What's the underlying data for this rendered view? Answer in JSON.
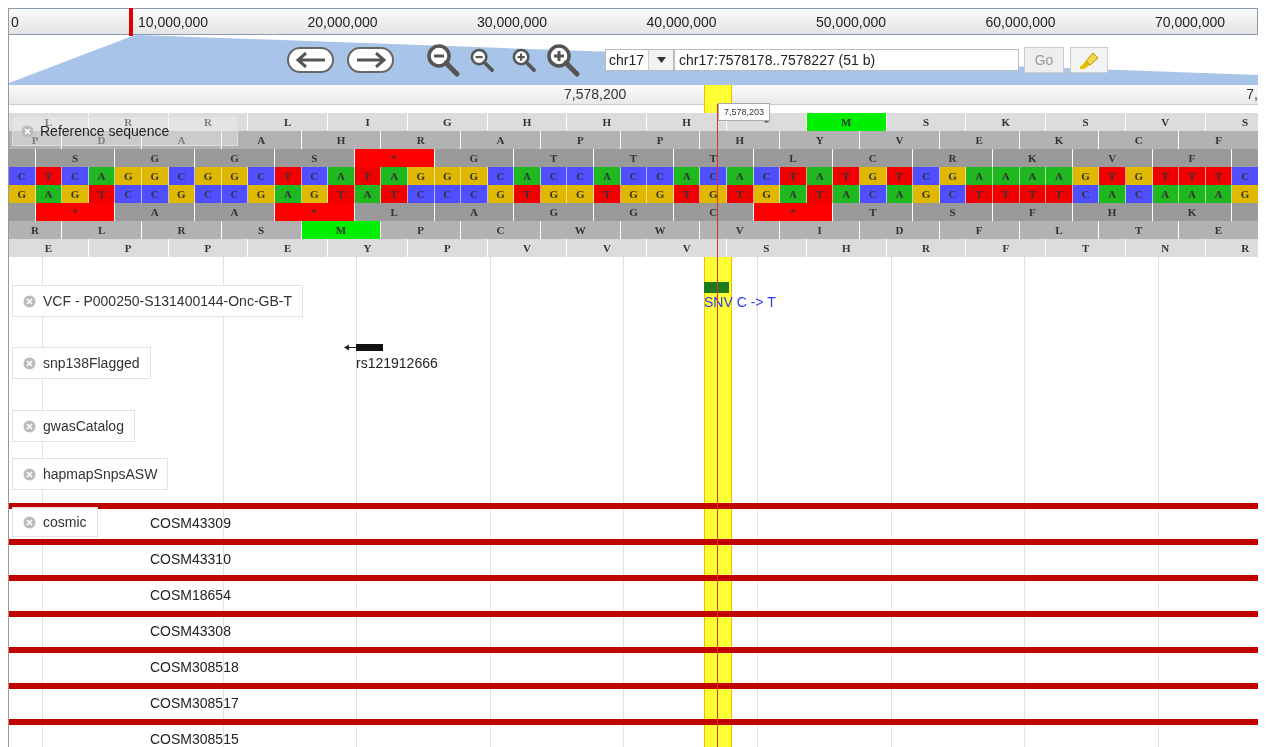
{
  "overview": {
    "ticks": [
      "0",
      "10,000,000",
      "20,000,000",
      "30,000,000",
      "40,000,000",
      "50,000,000",
      "60,000,000",
      "70,000,000"
    ]
  },
  "navigation": {
    "chromosome": "chr17",
    "location": "chr17:7578178..7578227 (51 b)",
    "go": {
      "label": "Go",
      "disabled": true
    }
  },
  "ruler": {
    "labels": [
      "7,578,200",
      "7,"
    ]
  },
  "position_tooltip": "7,578,203",
  "reference_track": {
    "label": "Reference sequence",
    "frames_top": [
      {
        "kind": "light",
        "cells": [
          {
            "aa": "L",
            "kind": "amino"
          },
          {
            "aa": "R",
            "kind": "amino"
          },
          {
            "aa": "R",
            "kind": "amino"
          },
          {
            "aa": "L",
            "kind": "amino"
          },
          {
            "aa": "I",
            "kind": "amino"
          },
          {
            "aa": "G",
            "kind": "amino"
          },
          {
            "aa": "H",
            "kind": "amino"
          },
          {
            "aa": "H",
            "kind": "amino"
          },
          {
            "aa": "H",
            "kind": "amino"
          },
          {
            "aa": "*",
            "kind": "amino"
          },
          {
            "aa": "M",
            "kind": "start"
          },
          {
            "aa": "S",
            "kind": "amino"
          },
          {
            "aa": "K",
            "kind": "amino"
          },
          {
            "aa": "S",
            "kind": "amino"
          },
          {
            "aa": "V",
            "kind": "amino"
          },
          {
            "aa": "S",
            "kind": "amino"
          }
        ]
      },
      {
        "kind": "medium",
        "cells": [
          {
            "aa": "P",
            "kind": "amino"
          },
          {
            "aa": "D",
            "kind": "amino"
          },
          {
            "aa": "A",
            "kind": "amino"
          },
          {
            "aa": "A",
            "kind": "amino"
          },
          {
            "aa": "H",
            "kind": "amino"
          },
          {
            "aa": "R",
            "kind": "amino"
          },
          {
            "aa": "A",
            "kind": "amino"
          },
          {
            "aa": "P",
            "kind": "amino"
          },
          {
            "aa": "P",
            "kind": "amino"
          },
          {
            "aa": "H",
            "kind": "amino"
          },
          {
            "aa": "Y",
            "kind": "amino"
          },
          {
            "aa": "V",
            "kind": "amino"
          },
          {
            "aa": "E",
            "kind": "amino"
          },
          {
            "aa": "K",
            "kind": "amino"
          },
          {
            "aa": "C",
            "kind": "amino"
          },
          {
            "aa": "F",
            "kind": "amino"
          }
        ]
      },
      {
        "kind": "dark",
        "cells": [
          {
            "kind": "blank"
          },
          {
            "aa": "S",
            "kind": "amino"
          },
          {
            "aa": "G",
            "kind": "amino"
          },
          {
            "aa": "G",
            "kind": "amino"
          },
          {
            "aa": "S",
            "kind": "amino"
          },
          {
            "aa": "*",
            "kind": "stop"
          },
          {
            "aa": "G",
            "kind": "amino"
          },
          {
            "aa": "T",
            "kind": "amino"
          },
          {
            "aa": "T",
            "kind": "amino"
          },
          {
            "aa": "T",
            "kind": "amino"
          },
          {
            "aa": "L",
            "kind": "amino"
          },
          {
            "aa": "C",
            "kind": "amino"
          },
          {
            "aa": "R",
            "kind": "amino"
          },
          {
            "aa": "K",
            "kind": "amino"
          },
          {
            "aa": "V",
            "kind": "amino"
          },
          {
            "aa": "F",
            "kind": "amino"
          },
          {
            "kind": "blank"
          }
        ]
      }
    ],
    "forward": [
      {
        "base": "C",
        "color": "#4f4fff"
      },
      {
        "base": "T",
        "color": "#f00000"
      },
      {
        "base": "C",
        "color": "#4f4fff"
      },
      {
        "base": "A",
        "color": "#1fb81f"
      },
      {
        "base": "G",
        "color": "#e0b800"
      },
      {
        "base": "G",
        "color": "#e0b800"
      },
      {
        "base": "C",
        "color": "#4f4fff"
      },
      {
        "base": "G",
        "color": "#e0b800"
      },
      {
        "base": "G",
        "color": "#e0b800"
      },
      {
        "base": "C",
        "color": "#4f4fff"
      },
      {
        "base": "T",
        "color": "#f00000"
      },
      {
        "base": "C",
        "color": "#4f4fff"
      },
      {
        "base": "A",
        "color": "#1fb81f"
      },
      {
        "base": "T",
        "color": "#f00000"
      },
      {
        "base": "A",
        "color": "#1fb81f"
      },
      {
        "base": "G",
        "color": "#e0b800"
      },
      {
        "base": "G",
        "color": "#e0b800"
      },
      {
        "base": "G",
        "color": "#e0b800"
      },
      {
        "base": "C",
        "color": "#4f4fff"
      },
      {
        "base": "A",
        "color": "#1fb81f"
      },
      {
        "base": "C",
        "color": "#4f4fff"
      },
      {
        "base": "C",
        "color": "#4f4fff"
      },
      {
        "base": "A",
        "color": "#1fb81f"
      },
      {
        "base": "C",
        "color": "#4f4fff"
      },
      {
        "base": "C",
        "color": "#4f4fff"
      },
      {
        "base": "A",
        "color": "#1fb81f"
      },
      {
        "base": "C",
        "color": "#4f4fff"
      },
      {
        "base": "A",
        "color": "#1fb81f"
      },
      {
        "base": "C",
        "color": "#4f4fff"
      },
      {
        "base": "T",
        "color": "#f00000"
      },
      {
        "base": "A",
        "color": "#1fb81f"
      },
      {
        "base": "T",
        "color": "#f00000"
      },
      {
        "base": "G",
        "color": "#e0b800"
      },
      {
        "base": "T",
        "color": "#f00000"
      },
      {
        "base": "C",
        "color": "#4f4fff"
      },
      {
        "base": "G",
        "color": "#e0b800"
      },
      {
        "base": "A",
        "color": "#1fb81f"
      },
      {
        "base": "A",
        "color": "#1fb81f"
      },
      {
        "base": "A",
        "color": "#1fb81f"
      },
      {
        "base": "A",
        "color": "#1fb81f"
      },
      {
        "base": "G",
        "color": "#e0b800"
      },
      {
        "base": "T",
        "color": "#f00000"
      },
      {
        "base": "G",
        "color": "#e0b800"
      },
      {
        "base": "T",
        "color": "#f00000"
      },
      {
        "base": "T",
        "color": "#f00000"
      },
      {
        "base": "T",
        "color": "#f00000"
      },
      {
        "base": "C",
        "color": "#4f4fff"
      }
    ],
    "reverse": [
      {
        "base": "G",
        "color": "#e0b800"
      },
      {
        "base": "A",
        "color": "#1fb81f"
      },
      {
        "base": "G",
        "color": "#e0b800"
      },
      {
        "base": "T",
        "color": "#f00000"
      },
      {
        "base": "C",
        "color": "#4f4fff"
      },
      {
        "base": "C",
        "color": "#4f4fff"
      },
      {
        "base": "G",
        "color": "#e0b800"
      },
      {
        "base": "C",
        "color": "#4f4fff"
      },
      {
        "base": "C",
        "color": "#4f4fff"
      },
      {
        "base": "G",
        "color": "#e0b800"
      },
      {
        "base": "A",
        "color": "#1fb81f"
      },
      {
        "base": "G",
        "color": "#e0b800"
      },
      {
        "base": "T",
        "color": "#f00000"
      },
      {
        "base": "A",
        "color": "#1fb81f"
      },
      {
        "base": "T",
        "color": "#f00000"
      },
      {
        "base": "C",
        "color": "#4f4fff"
      },
      {
        "base": "C",
        "color": "#4f4fff"
      },
      {
        "base": "C",
        "color": "#4f4fff"
      },
      {
        "base": "G",
        "color": "#e0b800"
      },
      {
        "base": "T",
        "color": "#f00000"
      },
      {
        "base": "G",
        "color": "#e0b800"
      },
      {
        "base": "G",
        "color": "#e0b800"
      },
      {
        "base": "T",
        "color": "#f00000"
      },
      {
        "base": "G",
        "color": "#e0b800"
      },
      {
        "base": "G",
        "color": "#e0b800"
      },
      {
        "base": "T",
        "color": "#f00000"
      },
      {
        "base": "G",
        "color": "#e0b800"
      },
      {
        "base": "T",
        "color": "#f00000"
      },
      {
        "base": "G",
        "color": "#e0b800"
      },
      {
        "base": "A",
        "color": "#1fb81f"
      },
      {
        "base": "T",
        "color": "#f00000"
      },
      {
        "base": "A",
        "color": "#1fb81f"
      },
      {
        "base": "C",
        "color": "#4f4fff"
      },
      {
        "base": "A",
        "color": "#1fb81f"
      },
      {
        "base": "G",
        "color": "#e0b800"
      },
      {
        "base": "C",
        "color": "#4f4fff"
      },
      {
        "base": "T",
        "color": "#f00000"
      },
      {
        "base": "T",
        "color": "#f00000"
      },
      {
        "base": "T",
        "color": "#f00000"
      },
      {
        "base": "T",
        "color": "#f00000"
      },
      {
        "base": "C",
        "color": "#4f4fff"
      },
      {
        "base": "A",
        "color": "#1fb81f"
      },
      {
        "base": "C",
        "color": "#4f4fff"
      },
      {
        "base": "A",
        "color": "#1fb81f"
      },
      {
        "base": "A",
        "color": "#1fb81f"
      },
      {
        "base": "A",
        "color": "#1fb81f"
      },
      {
        "base": "G",
        "color": "#e0b800"
      }
    ],
    "frames_bottom": [
      {
        "kind": "dark",
        "cells": [
          {
            "kind": "blank"
          },
          {
            "aa": "*",
            "kind": "stop"
          },
          {
            "aa": "A",
            "kind": "amino"
          },
          {
            "aa": "A",
            "kind": "amino"
          },
          {
            "aa": "*",
            "kind": "stop"
          },
          {
            "aa": "L",
            "kind": "amino"
          },
          {
            "aa": "A",
            "kind": "amino"
          },
          {
            "aa": "G",
            "kind": "amino"
          },
          {
            "aa": "G",
            "kind": "amino"
          },
          {
            "aa": "C",
            "kind": "amino"
          },
          {
            "aa": "*",
            "kind": "stop"
          },
          {
            "aa": "T",
            "kind": "amino"
          },
          {
            "aa": "S",
            "kind": "amino"
          },
          {
            "aa": "F",
            "kind": "amino"
          },
          {
            "aa": "H",
            "kind": "amino"
          },
          {
            "aa": "K",
            "kind": "amino"
          },
          {
            "kind": "blank"
          }
        ]
      },
      {
        "kind": "medium",
        "cells": [
          {
            "aa": "R",
            "kind": "amino"
          },
          {
            "aa": "L",
            "kind": "amino"
          },
          {
            "aa": "R",
            "kind": "amino"
          },
          {
            "aa": "S",
            "kind": "amino"
          },
          {
            "aa": "M",
            "kind": "start"
          },
          {
            "aa": "P",
            "kind": "amino"
          },
          {
            "aa": "C",
            "kind": "amino"
          },
          {
            "aa": "W",
            "kind": "amino"
          },
          {
            "aa": "W",
            "kind": "amino"
          },
          {
            "aa": "V",
            "kind": "amino"
          },
          {
            "aa": "I",
            "kind": "amino"
          },
          {
            "aa": "D",
            "kind": "amino"
          },
          {
            "aa": "F",
            "kind": "amino"
          },
          {
            "aa": "L",
            "kind": "amino"
          },
          {
            "aa": "T",
            "kind": "amino"
          },
          {
            "aa": "E",
            "kind": "amino"
          }
        ]
      },
      {
        "kind": "light",
        "cells": [
          {
            "aa": "E",
            "kind": "amino"
          },
          {
            "aa": "P",
            "kind": "amino"
          },
          {
            "aa": "P",
            "kind": "amino"
          },
          {
            "aa": "E",
            "kind": "amino"
          },
          {
            "aa": "Y",
            "kind": "amino"
          },
          {
            "aa": "P",
            "kind": "amino"
          },
          {
            "aa": "V",
            "kind": "amino"
          },
          {
            "aa": "V",
            "kind": "amino"
          },
          {
            "aa": "V",
            "kind": "amino"
          },
          {
            "aa": "S",
            "kind": "amino"
          },
          {
            "aa": "H",
            "kind": "amino"
          },
          {
            "aa": "R",
            "kind": "amino"
          },
          {
            "aa": "F",
            "kind": "amino"
          },
          {
            "aa": "T",
            "kind": "amino"
          },
          {
            "aa": "N",
            "kind": "amino"
          },
          {
            "aa": "R",
            "kind": "amino"
          }
        ]
      }
    ]
  },
  "tracks": [
    {
      "label": "VCF - P000250-S131400144-Onc-GB-T",
      "kind": "vcf",
      "features": [
        {
          "label": "SNV C -> T"
        }
      ]
    },
    {
      "label": "snp138Flagged",
      "kind": "snp",
      "features": [
        {
          "label": "rs121912666"
        }
      ]
    },
    {
      "label": "gwasCatalog",
      "kind": "empty"
    },
    {
      "label": "hapmapSnpsASW",
      "kind": "empty"
    },
    {
      "label": "cosmic",
      "kind": "cosmic",
      "features": [
        {
          "label": "COSM43309"
        },
        {
          "label": "COSM43310"
        },
        {
          "label": "COSM18654"
        },
        {
          "label": "COSM43308"
        },
        {
          "label": "COSM308518"
        },
        {
          "label": "COSM308517"
        },
        {
          "label": "COSM308515"
        }
      ]
    }
  ]
}
